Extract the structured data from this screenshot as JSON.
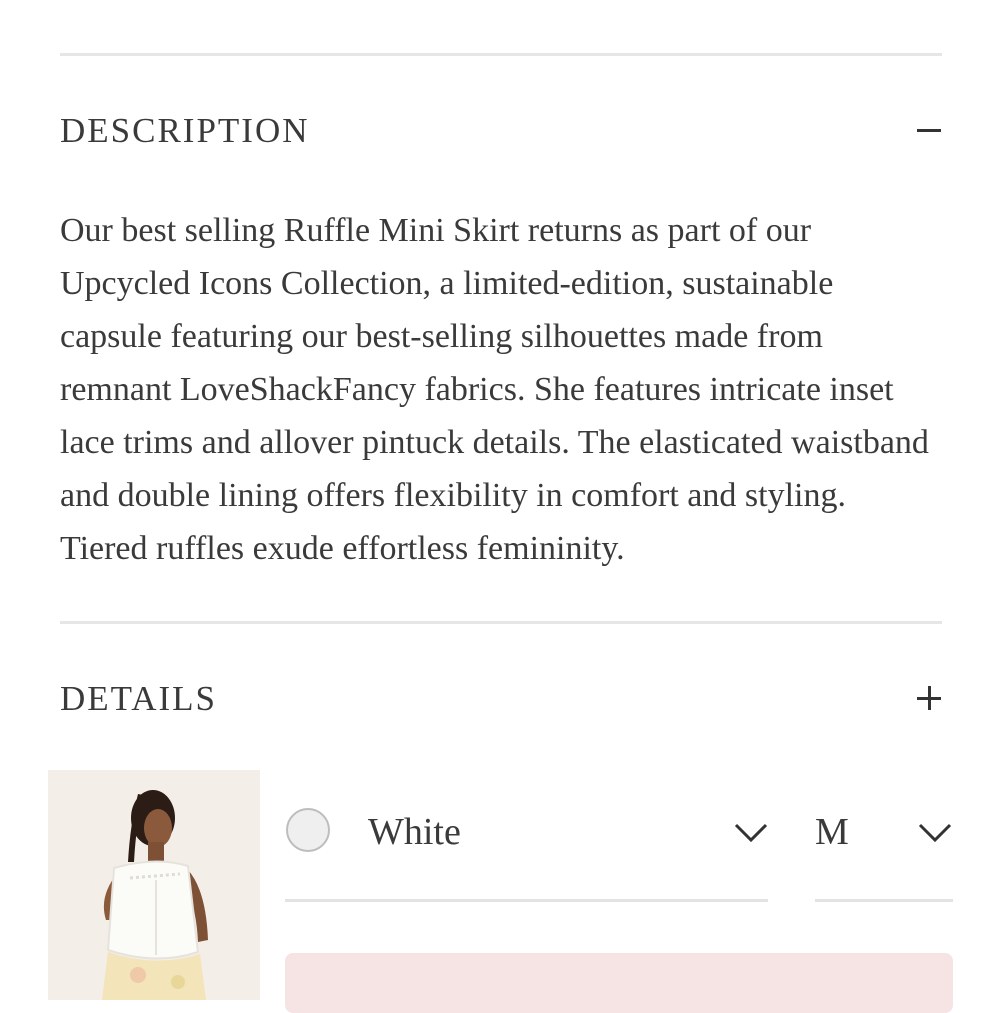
{
  "description": {
    "title": "DESCRIPTION",
    "toggle_icon": "minus-icon",
    "text": "Our best selling Ruffle Mini Skirt returns as part of our Upcycled Icons Collection, a limited-edition, sustainable capsule featuring our best-selling silhouettes made from remnant LoveShackFancy fabrics. She features intricate inset lace trims and allover pintuck details. The elasticated waistband and double lining offers flexibility in comfort and styling. Tiered ruffles exude effortless femininity."
  },
  "details": {
    "title": "DETAILS",
    "toggle_icon": "plus-icon"
  },
  "product_selector": {
    "color": {
      "selected": "White",
      "swatch_color": "#efefef",
      "icon": "chevron-down-icon"
    },
    "size": {
      "selected": "M",
      "icon": "chevron-down-icon"
    },
    "add_button_color": "#f6e3e3"
  }
}
